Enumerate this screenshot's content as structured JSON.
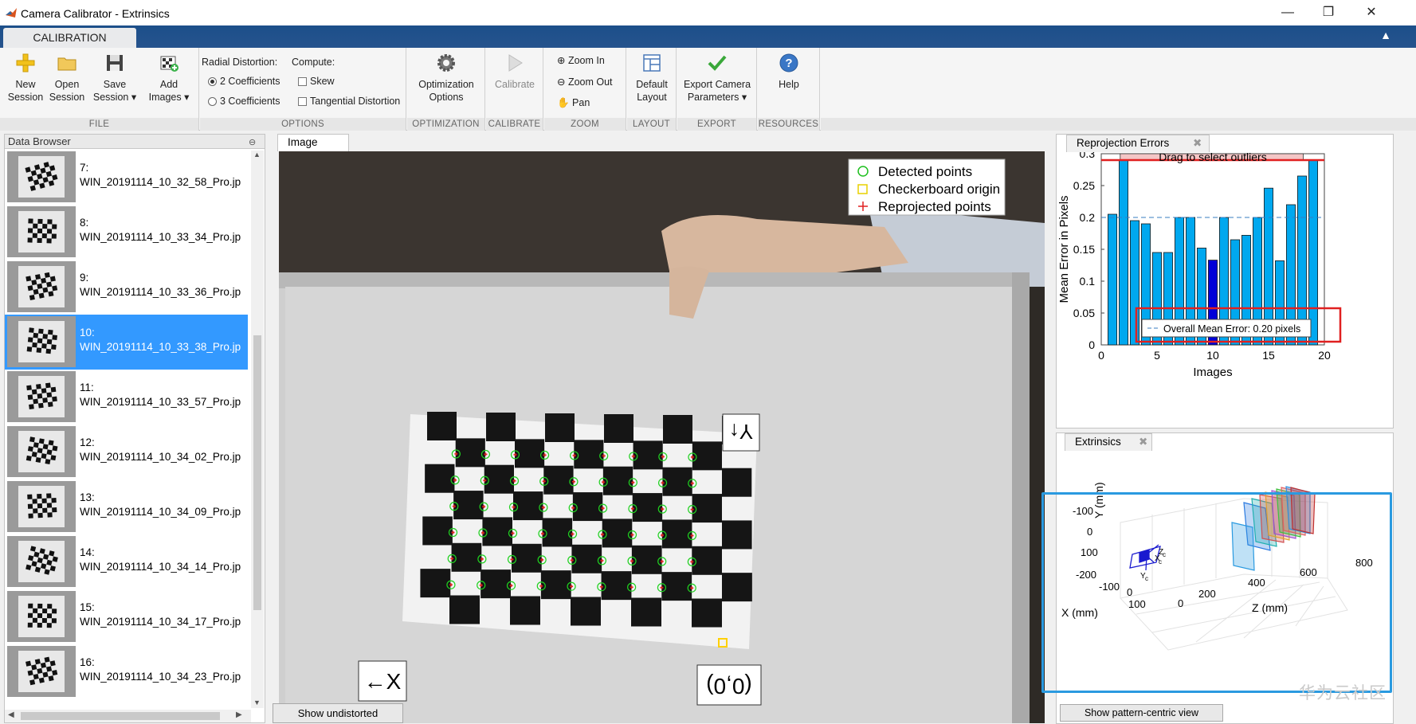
{
  "window": {
    "title": "Camera Calibrator - Extrinsics",
    "minimize": "—",
    "restore": "❐",
    "close": "✕"
  },
  "ribbon": {
    "tab": "CALIBRATION",
    "file": {
      "label": "FILE",
      "new": [
        "New",
        "Session"
      ],
      "open": [
        "Open",
        "Session"
      ],
      "save": [
        "Save",
        "Session ▾"
      ],
      "add": [
        "Add",
        "Images ▾"
      ]
    },
    "options": {
      "label": "OPTIONS",
      "radial_title": "Radial Distortion:",
      "radial_2": "2 Coefficients",
      "radial_3": "3 Coefficients",
      "radial_selected": "2 Coefficients",
      "compute_title": "Compute:",
      "skew": "Skew",
      "tangential": "Tangential Distortion"
    },
    "optimization": {
      "label": "OPTIMIZATION",
      "button": [
        "Optimization",
        "Options"
      ]
    },
    "calibrate": {
      "label": "CALIBRATE",
      "button": "Calibrate"
    },
    "zoom": {
      "label": "ZOOM",
      "zoom_in": "Zoom In",
      "zoom_out": "Zoom Out",
      "pan": "Pan"
    },
    "layout": {
      "label": "LAYOUT",
      "button": [
        "Default",
        "Layout"
      ]
    },
    "export": {
      "label": "EXPORT",
      "button": [
        "Export Camera",
        "Parameters ▾"
      ]
    },
    "resources": {
      "label": "RESOURCES",
      "button": "Help"
    }
  },
  "data_browser": {
    "title": "Data Browser",
    "selected_index": 3,
    "items": [
      {
        "num": "7:",
        "name": "WIN_20191114_10_32_58_Pro.jp"
      },
      {
        "num": "8:",
        "name": "WIN_20191114_10_33_34_Pro.jp"
      },
      {
        "num": "9:",
        "name": "WIN_20191114_10_33_36_Pro.jp"
      },
      {
        "num": "10:",
        "name": "WIN_20191114_10_33_38_Pro.jp"
      },
      {
        "num": "11:",
        "name": "WIN_20191114_10_33_57_Pro.jp"
      },
      {
        "num": "12:",
        "name": "WIN_20191114_10_34_02_Pro.jp"
      },
      {
        "num": "13:",
        "name": "WIN_20191114_10_34_09_Pro.jp"
      },
      {
        "num": "14:",
        "name": "WIN_20191114_10_34_14_Pro.jp"
      },
      {
        "num": "15:",
        "name": "WIN_20191114_10_34_17_Pro.jp"
      },
      {
        "num": "16:",
        "name": "WIN_20191114_10_34_23_Pro.jp"
      }
    ]
  },
  "image_panel": {
    "tab": "Image",
    "legend": {
      "detected": "Detected points",
      "origin": "Checkerboard origin",
      "reprojected": "Reprojected points"
    },
    "axis_labels": {
      "y": "Y↑",
      "x": "←X",
      "origin": "(0,0)"
    },
    "show_undistorted": "Show undistorted"
  },
  "reprojection_panel": {
    "tab": "Reprojection Errors"
  },
  "extrinsics_panel": {
    "tab": "Extrinsics",
    "ylabel": "Y (mm)",
    "xlabel": "X (mm)",
    "zlabel": "Z (mm)",
    "yticks": [
      "-100",
      "0",
      "100",
      "-200"
    ],
    "xticks": [
      "-100",
      "0",
      "100"
    ],
    "zticks": [
      "0",
      "200",
      "400",
      "600",
      "800"
    ],
    "cam_labels": [
      "Z",
      "X",
      "Y",
      "c",
      "c",
      "c"
    ],
    "show_pattern_centric": "Show pattern-centric view"
  },
  "watermark": "华为云社区",
  "colors": {
    "accent_blue": "#2a9ae0",
    "selection": "#3399ff",
    "bar": "#00a8ef",
    "bar_selected": "#0000d8",
    "outlier_line": "#e02020",
    "mean_line": "#3a7cc0"
  },
  "chart_data": {
    "type": "bar",
    "xlabel": "Images",
    "ylabel": "Mean Error in Pixels",
    "overlay_text": "Drag to select outliers",
    "legend": "Overall Mean Error: 0.20 pixels",
    "xlim": [
      0,
      20
    ],
    "ylim": [
      0,
      0.3
    ],
    "xticks": [
      0,
      5,
      10,
      15,
      20
    ],
    "yticks": [
      0,
      0.05,
      0.1,
      0.15,
      0.2,
      0.25,
      0.3
    ],
    "mean": 0.2,
    "outlier_threshold": 0.29,
    "selected_image": 10,
    "categories": [
      1,
      2,
      3,
      4,
      5,
      6,
      7,
      8,
      9,
      10,
      11,
      12,
      13,
      14,
      15,
      16,
      17,
      18,
      19
    ],
    "values": [
      0.205,
      0.29,
      0.195,
      0.19,
      0.145,
      0.145,
      0.2,
      0.2,
      0.152,
      0.133,
      0.2,
      0.165,
      0.172,
      0.2,
      0.246,
      0.132,
      0.22,
      0.265,
      0.29
    ]
  }
}
